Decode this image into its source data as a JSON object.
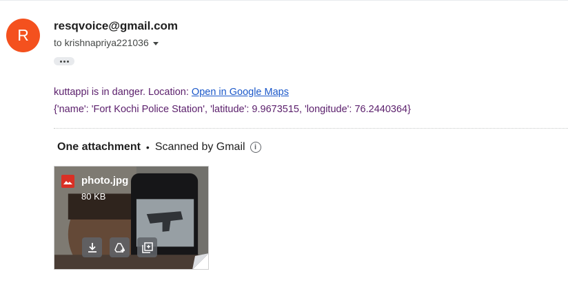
{
  "colors": {
    "avatar_bg": "#f4511e",
    "body_text": "#5a1e6b",
    "link": "#1a57c9",
    "file_icon": "#d93025"
  },
  "sender": {
    "avatar_letter": "R",
    "email": "resqvoice@gmail.com"
  },
  "recipient": {
    "label": "to krishnapriya221036"
  },
  "message": {
    "line1_text": "kuttappi is in danger. Location: ",
    "link_text": "Open in Google Maps",
    "line2": "{'name': 'Fort Kochi Police Station', 'latitude': 9.9673515, 'longitude': 76.2440364}"
  },
  "attachments": {
    "count_label": "One attachment",
    "separator": "•",
    "scan_label": "Scanned by Gmail",
    "info_icon_glyph": "i",
    "file": {
      "name": "photo.jpg",
      "size": "80 KB",
      "type_icon": "image-icon",
      "actions": [
        "download-icon",
        "add-to-drive-icon",
        "save-to-photos-icon"
      ]
    }
  }
}
